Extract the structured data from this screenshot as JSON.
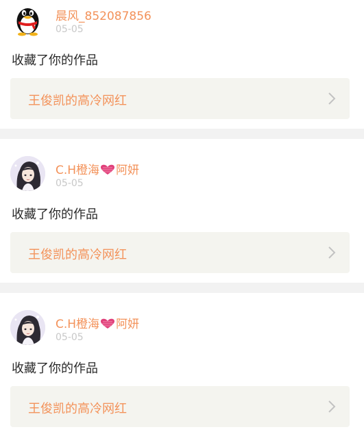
{
  "notifications": [
    {
      "username": "晨风_852087856",
      "username_prefix": "",
      "username_suffix": "",
      "date": "05-05",
      "action": "收藏了你的作品",
      "work_title": "王俊凯的高冷网红",
      "avatar_icon": "qq-penguin-icon"
    },
    {
      "username": "",
      "username_prefix": "C.H橙海",
      "username_suffix": "阿妍",
      "date": "05-05",
      "action": "收藏了你的作品",
      "work_title": "王俊凯的高冷网红",
      "avatar_icon": "girl-avatar-icon"
    },
    {
      "username": "",
      "username_prefix": "C.H橙海",
      "username_suffix": "阿妍",
      "date": "05-05",
      "action": "收藏了你的作品",
      "work_title": "王俊凯的高冷网红",
      "avatar_icon": "girl-avatar-icon"
    }
  ],
  "colors": {
    "accent": "#f3925a",
    "date": "#c8c8c8",
    "text": "#2a2a2a",
    "link_bg": "#f4f4ef",
    "divider": "#f2f2f2",
    "heart": "#e0407a"
  }
}
